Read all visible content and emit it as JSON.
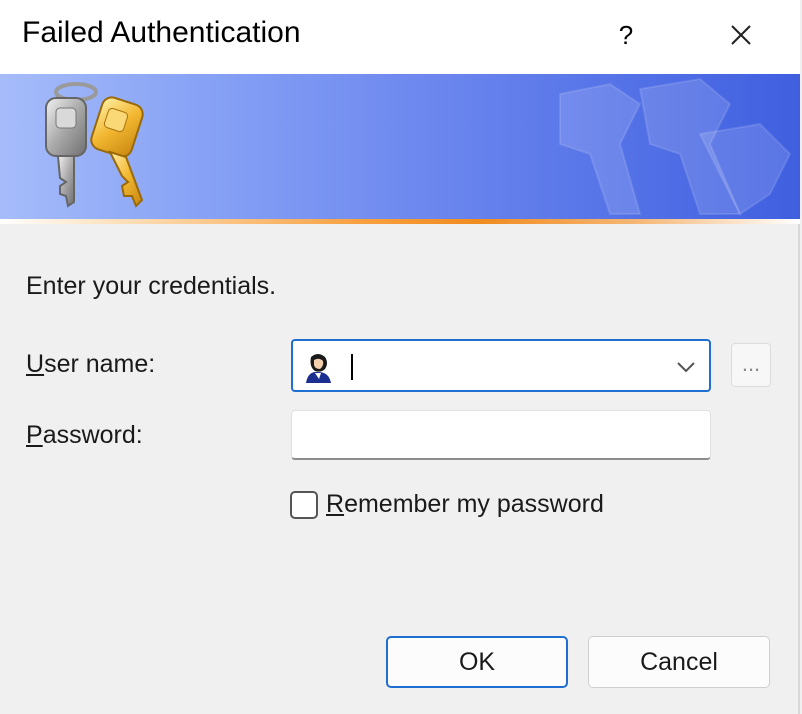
{
  "window": {
    "title": "Failed Authentication",
    "help_label": "?"
  },
  "form": {
    "intro": "Enter your credentials.",
    "username_label_accel": "U",
    "username_label_rest": "ser name:",
    "username_value": "",
    "browse_label": "...",
    "password_label_accel": "P",
    "password_label_rest": "assword:",
    "password_value": "",
    "remember_label_accel": "R",
    "remember_label_rest": "emember my password",
    "remember_checked": false
  },
  "buttons": {
    "ok": "OK",
    "cancel": "Cancel"
  },
  "icons": {
    "banner": "keys-icon",
    "user": "user-icon",
    "close": "close-icon",
    "dropdown": "chevron-down-icon"
  },
  "colors": {
    "accent": "#1f6fd1",
    "banner_start": "#a6bcfa",
    "banner_end": "#3f5fe0",
    "banner_line": "#f08b20"
  }
}
